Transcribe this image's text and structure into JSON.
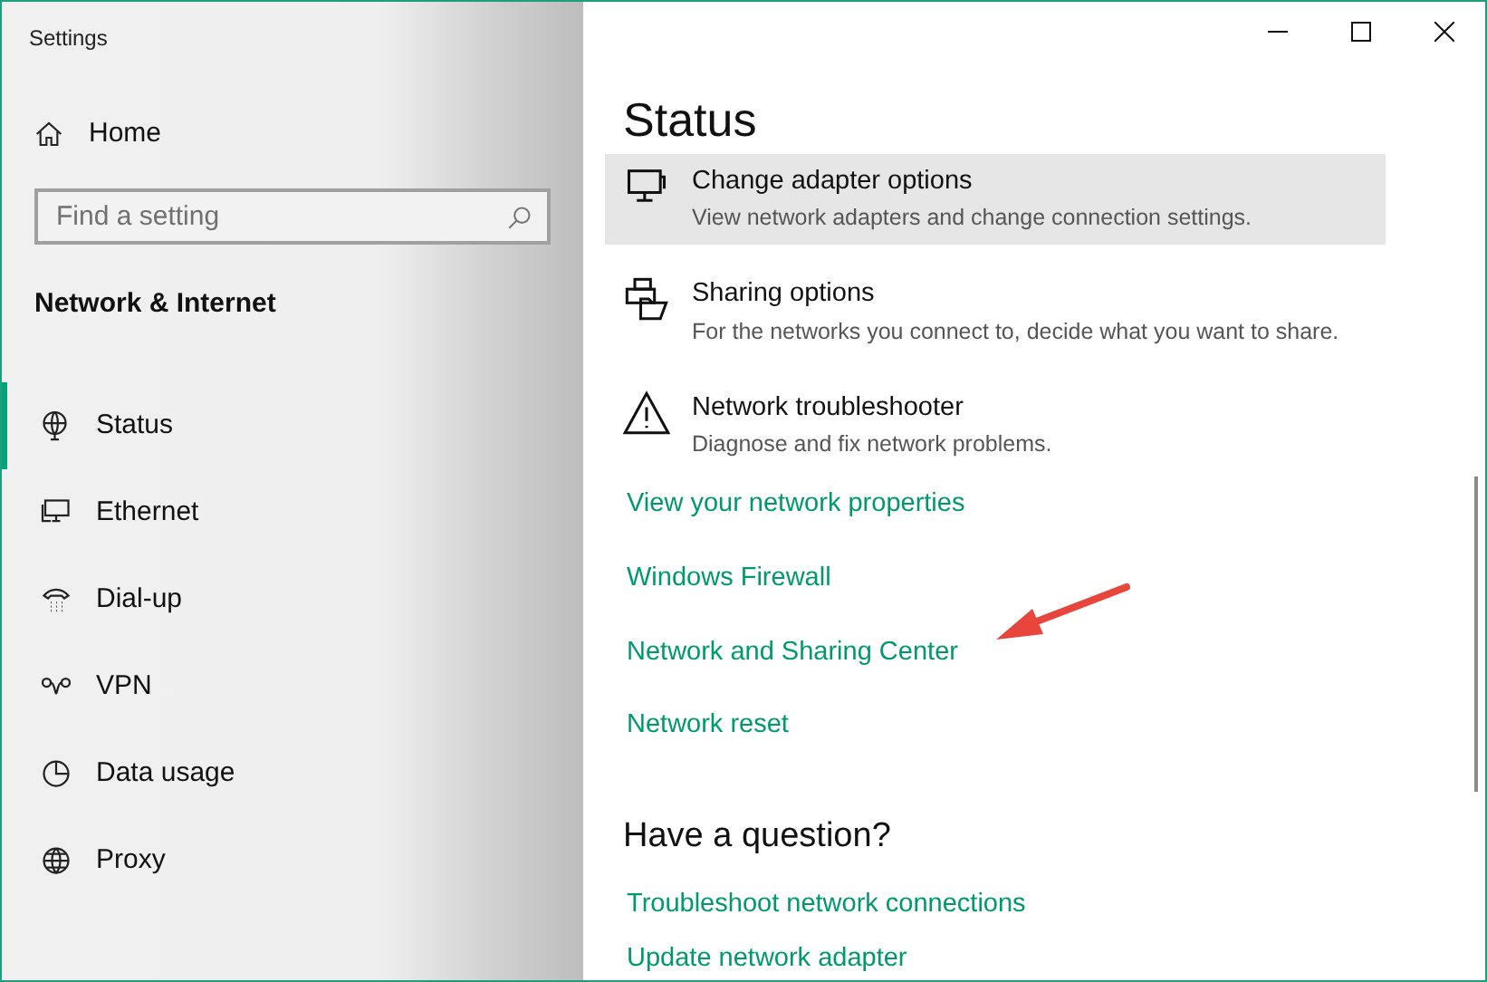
{
  "window": {
    "title": "Settings"
  },
  "sidebar": {
    "home": "Home",
    "search": {
      "placeholder": "Find a setting"
    },
    "section": "Network & Internet",
    "items": [
      {
        "label": "Status",
        "kind": "status",
        "selected": true
      },
      {
        "label": "Ethernet",
        "kind": "ethernet",
        "selected": false
      },
      {
        "label": "Dial-up",
        "kind": "dialup",
        "selected": false
      },
      {
        "label": "VPN",
        "kind": "vpn",
        "selected": false
      },
      {
        "label": "Data usage",
        "kind": "data",
        "selected": false
      },
      {
        "label": "Proxy",
        "kind": "proxy",
        "selected": false
      }
    ]
  },
  "content": {
    "title": "Status",
    "options": [
      {
        "title": "Change adapter options",
        "description": "View network adapters and change connection settings.",
        "kind": "adapter",
        "selected": true
      },
      {
        "title": "Sharing options",
        "description": "For the networks you connect to, decide what you want to share.",
        "kind": "sharing",
        "selected": false
      },
      {
        "title": "Network troubleshooter",
        "description": "Diagnose and fix network problems.",
        "kind": "warning",
        "selected": false
      }
    ],
    "links": [
      "View your network properties",
      "Windows Firewall",
      "Network and Sharing Center",
      "Network reset"
    ],
    "question_heading": "Have a question?",
    "help_links": [
      "Troubleshoot network connections",
      "Update network adapter"
    ]
  }
}
